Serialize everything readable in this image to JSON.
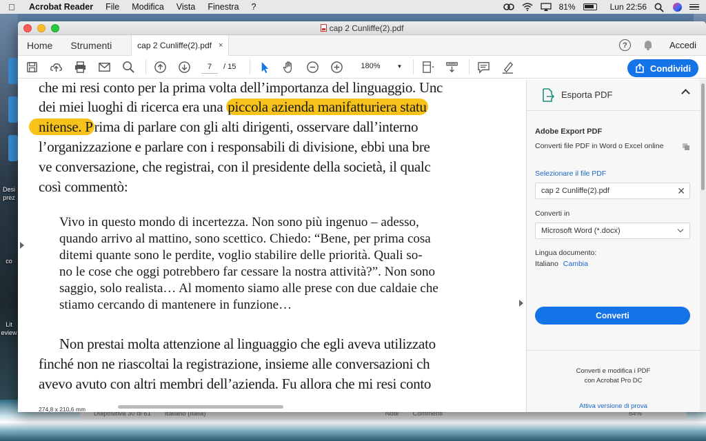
{
  "menubar": {
    "app_name": "Acrobat Reader",
    "menus": [
      "File",
      "Modifica",
      "Vista",
      "Finestra",
      "?"
    ],
    "battery": "81%",
    "clock": "Lun 22:56"
  },
  "desktop": {
    "labels": [
      "Desi",
      "prez",
      "co",
      "Lit",
      "eview"
    ]
  },
  "window": {
    "title": "cap 2 Cunliffe(2).pdf"
  },
  "tabs": {
    "home": "Home",
    "tools": "Strumenti",
    "document": "cap 2 Cunliffe(2).pdf",
    "close": "×",
    "help": "?",
    "signin": "Accedi"
  },
  "toolbar": {
    "page_current": "7",
    "page_total": "/  15",
    "zoom": "180%",
    "share_label": "Condividi",
    "icons": [
      "save-icon",
      "upload-icon",
      "print-icon",
      "mail-icon",
      "search-icon",
      "prev-page-icon",
      "next-page-icon",
      "select-cursor-icon",
      "hand-icon",
      "zoom-out-icon",
      "zoom-in-icon",
      "page-fit-icon",
      "scroll-mode-icon",
      "comment-icon",
      "highlight-pen-icon"
    ]
  },
  "document": {
    "lines": [
      {
        "before": "che mi resi conto per la prima volta dell’importanza del linguaggio. Unc",
        "hl": "",
        "after": ""
      },
      {
        "before": "dei miei luoghi di ricerca era una ",
        "hl": "piccola azienda manifatturiera statu",
        "after": ""
      },
      {
        "before": "",
        "hl": "nitense. P",
        "after": "rima di parlare con gli alti dirigenti, osservare dall’interno"
      },
      {
        "before": "l’organizzazione e parlare con i responsabili di divisione, ebbi una bre",
        "hl": "",
        "after": ""
      },
      {
        "before": "ve conversazione, che registrai, con il presidente della società, il qualc",
        "hl": "",
        "after": ""
      },
      {
        "before": "così commentò:",
        "hl": "",
        "after": ""
      }
    ],
    "quote": [
      "Vivo in questo mondo di incertezza. Non sono più ingenuo – adesso,",
      "quando arrivo al mattino, sono scettico. Chiedo: “Bene, per prima cosa",
      "ditemi quante sono le perdite, voglio stabilire delle priorità. Quali so-",
      "no le cose che oggi potrebbero far cessare la nostra attività?”. Non sono",
      "saggio, solo realista… Al momento siamo alle prese con due caldaie che",
      "stiamo cercando di mantenere in funzione…"
    ],
    "tail": [
      "Non prestai molta attenzione al linguaggio che egli aveva utilizzato",
      "finché non ne riascoltai la registrazione, insieme alle conversazioni ch",
      "avevo avuto con altri membri dell’azienda. Fu allora che mi resi conto"
    ],
    "page_size": "274,8 x 210,6 mm",
    "highlight_color": "#f7c31b"
  },
  "panel": {
    "title": "Esporta PDF",
    "heading": "Adobe Export PDF",
    "description": "Converti file PDF in Word o Excel online",
    "select_file": "Selezionare il file PDF",
    "file_value": "cap 2 Cunliffe(2).pdf",
    "convert_to_label": "Converti in",
    "convert_to_value": "Microsoft Word (*.docx)",
    "language_label": "Lingua documento:",
    "language_value": "Italiano",
    "language_change": "Cambia",
    "convert_button": "Converti",
    "promo_line1": "Converti e modifica i PDF",
    "promo_line2": "con Acrobat Pro DC",
    "trial_link": "Attiva versione di prova"
  },
  "bg_status": {
    "slide": "Diapositiva 30 di 61",
    "lang": "Italiano (Italia)",
    "notes": "Note",
    "comments": "Commenti",
    "zoom": "84%"
  },
  "colors": {
    "accent": "#1473e6",
    "link": "#1a66c9"
  }
}
